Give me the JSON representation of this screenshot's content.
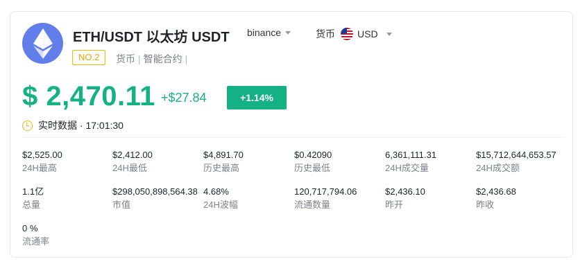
{
  "header": {
    "title": "ETH/USDT 以太坊 USDT",
    "exchange": "binance",
    "currency_label": "货币",
    "currency_value": "USD",
    "rank": "NO.2",
    "tags": [
      "货币",
      "智能合约"
    ]
  },
  "price": {
    "value": "$ 2,470.11",
    "change": "+$27.84",
    "change_pct": "+1.14%"
  },
  "realtime": {
    "label": "实时数据 · 17:01:30"
  },
  "stats": [
    {
      "value": "$2,525.00",
      "label": "24H最高"
    },
    {
      "value": "$2,412.00",
      "label": "24H最低"
    },
    {
      "value": "$4,891.70",
      "label": "历史最高"
    },
    {
      "value": "$0.42090",
      "label": "历史最低"
    },
    {
      "value": "6,361,111.31",
      "label": "24H成交量"
    },
    {
      "value": "$15,712,644,653.57",
      "label": "24H成交额"
    },
    {
      "value": "1.1亿",
      "label": "总量"
    },
    {
      "value": "$298,050,898,564.38",
      "label": "市值"
    },
    {
      "value": "4.68%",
      "label": "24H波幅"
    },
    {
      "value": "120,717,794.06",
      "label": "流通数量"
    },
    {
      "value": "$2,436.10",
      "label": "昨开"
    },
    {
      "value": "$2,436.68",
      "label": "昨收"
    },
    {
      "value": "0 %",
      "label": "流通率"
    }
  ],
  "colors": {
    "accent_green": "#14b184",
    "rank_yellow": "#f0b90b",
    "eth_blue": "#627eea"
  },
  "icons": {
    "logo": "ethereum-icon",
    "flag": "us-flag-icon",
    "clock": "clock-icon"
  }
}
